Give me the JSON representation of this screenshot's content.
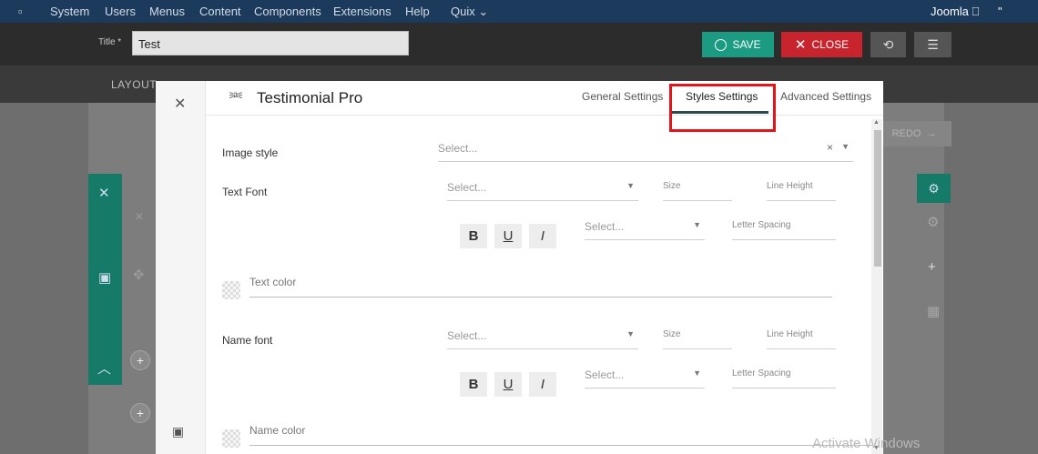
{
  "topbar": {
    "menu_icon": "square-icon",
    "items": [
      "System",
      "Users",
      "Menus",
      "Content",
      "Components",
      "Extensions",
      "Help",
      "Quix ⌄"
    ],
    "site_link": "Joomla ⎕",
    "user_menu": "\""
  },
  "toolbar": {
    "title_label": "Title *",
    "title_value": "Test",
    "save_label": "SAVE",
    "close_label": "CLOSE",
    "sync_icon": "refresh-icon",
    "menu_icon": "hamburger-icon"
  },
  "subbar": {
    "layout_tab": "LAYOUT"
  },
  "background": {
    "redo_label": "REDO"
  },
  "modal": {
    "title": "Testimonial Pro",
    "tabs": [
      {
        "label": "General Settings",
        "active": false
      },
      {
        "label": "Styles Settings",
        "active": true
      },
      {
        "label": "Advanced Settings",
        "active": false
      }
    ],
    "fields": {
      "image_style": {
        "label": "Image style",
        "placeholder": "Select...",
        "clear": "×"
      },
      "text_font": {
        "label": "Text Font",
        "placeholder": "Select...",
        "size": "Size",
        "line_height": "Line Height",
        "style_select": "Select...",
        "letter_spacing": "Letter Spacing"
      },
      "text_color": {
        "label": "Text color"
      },
      "name_font": {
        "label": "Name font",
        "placeholder": "Select...",
        "size": "Size",
        "line_height": "Line Height",
        "style_select": "Select...",
        "letter_spacing": "Letter Spacing"
      },
      "name_color": {
        "label": "Name color"
      }
    },
    "format_buttons": [
      "B",
      "U",
      "I"
    ]
  },
  "watermark": "Activate Windows",
  "colors": {
    "topbar": "#1c3a5c",
    "save": "#1b9c82",
    "close": "#c8242d",
    "highlight": "#e0161c",
    "tab_underline": "#2f4a4f"
  }
}
